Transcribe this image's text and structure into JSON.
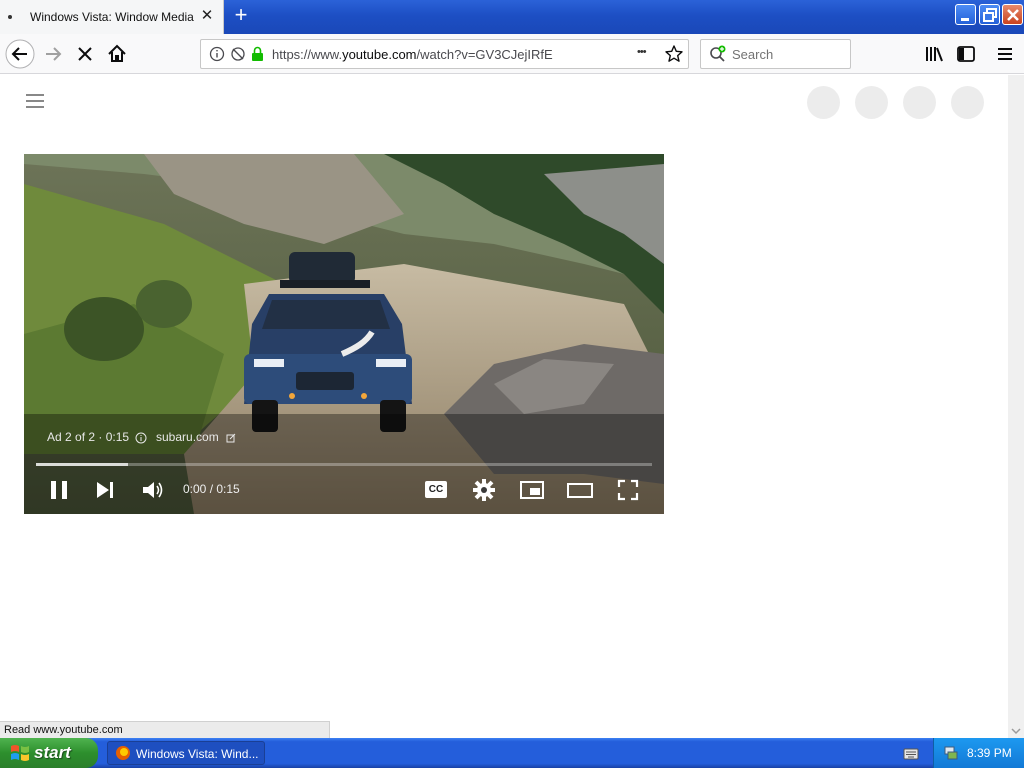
{
  "browser": {
    "tab_title": "Windows Vista: Window Media Player",
    "tab_close_glyph": "✕",
    "new_tab_glyph": "+",
    "url_prefix": "https://www.",
    "url_domain": "youtube.com",
    "url_rest": "/watch?v=GV3CJejIRfE",
    "search_placeholder": "Search",
    "page_actions_glyph": "•••",
    "status_text": "Read www.youtube.com"
  },
  "video": {
    "ad_info": "Ad 2 of 2 · 0:15",
    "ad_link": "subaru.com",
    "time": "0:00 / 0:15",
    "progress_fraction": 0.15,
    "cc_label": "CC"
  },
  "taskbar": {
    "start_label": "start",
    "window_label": "Windows Vista: Wind...",
    "clock": "8:39 PM"
  },
  "colors": {
    "taskbar_blue": "#245edb",
    "start_green": "#3c9a3c",
    "secure_green": "#12bc00",
    "player_bg": "#2c3a2c"
  }
}
